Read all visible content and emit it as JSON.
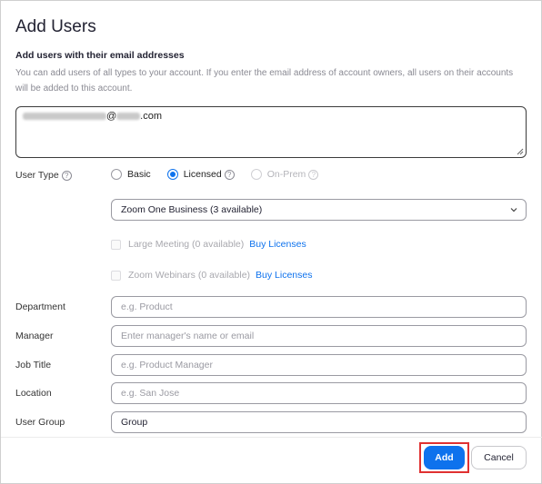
{
  "dialog": {
    "title": "Add Users",
    "section_heading": "Add users with their email addresses",
    "section_description": "You can add users of all types to your account. If you enter the email address of account owners, all users on their accounts will be added to this account.",
    "email": {
      "at_sign": "@",
      "domain_suffix": ".com"
    }
  },
  "user_type": {
    "label": "User Type",
    "options": [
      {
        "label": "Basic",
        "checked": false,
        "disabled": false
      },
      {
        "label": "Licensed",
        "checked": true,
        "disabled": false
      },
      {
        "label": "On-Prem",
        "checked": false,
        "disabled": true
      }
    ]
  },
  "plan_select": {
    "value": "Zoom One Business (3 available)"
  },
  "addons": [
    {
      "label": "Large Meeting (0 available)",
      "link": "Buy Licenses"
    },
    {
      "label": "Zoom Webinars (0 available)",
      "link": "Buy Licenses"
    }
  ],
  "fields": {
    "department": {
      "label": "Department",
      "placeholder": "e.g. Product",
      "value": ""
    },
    "manager": {
      "label": "Manager",
      "placeholder": "Enter manager's name or email",
      "value": ""
    },
    "job_title": {
      "label": "Job Title",
      "placeholder": "e.g. Product Manager",
      "value": ""
    },
    "location": {
      "label": "Location",
      "placeholder": "e.g. San Jose",
      "value": ""
    },
    "user_group": {
      "label": "User Group",
      "placeholder": "",
      "value": "Group"
    }
  },
  "buttons": {
    "add": "Add",
    "cancel": "Cancel"
  },
  "colors": {
    "accent": "#0e72ed",
    "highlight": "#e03131"
  }
}
